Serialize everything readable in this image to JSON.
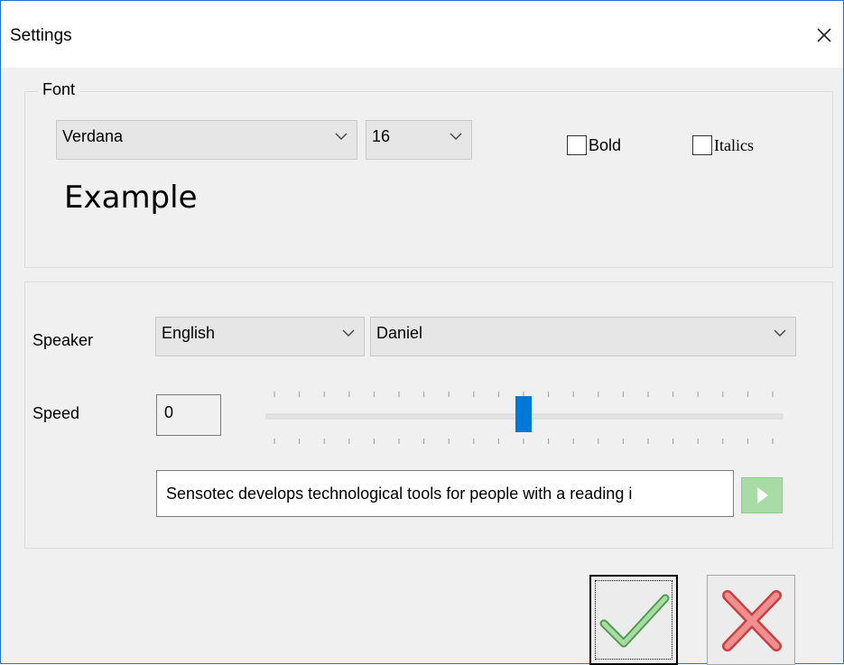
{
  "window": {
    "title": "Settings"
  },
  "font_group": {
    "legend": "Font",
    "font_family": "Verdana",
    "font_size": "16",
    "bold_label": "Bold",
    "bold_checked": false,
    "italics_label": "Italics",
    "italics_checked": false,
    "preview_text": "Example"
  },
  "speech_group": {
    "speaker_label": "Speaker",
    "language": "English",
    "voice": "Daniel",
    "speed_label": "Speed",
    "speed_value": "0",
    "speed_slider_position": 0.5,
    "sample_text": "Sensotec develops technological tools for people with a reading i"
  },
  "icons": {
    "close": "close-icon",
    "chevron": "chevron-down-icon",
    "play": "play-icon",
    "ok": "checkmark-icon",
    "cancel": "red-x-icon"
  },
  "colors": {
    "accent": "#0078d7",
    "play_bg": "#a9dba7",
    "check_green": "#6cc56a",
    "cancel_red": "#e36b6b",
    "window_border": "#1e74c9"
  }
}
